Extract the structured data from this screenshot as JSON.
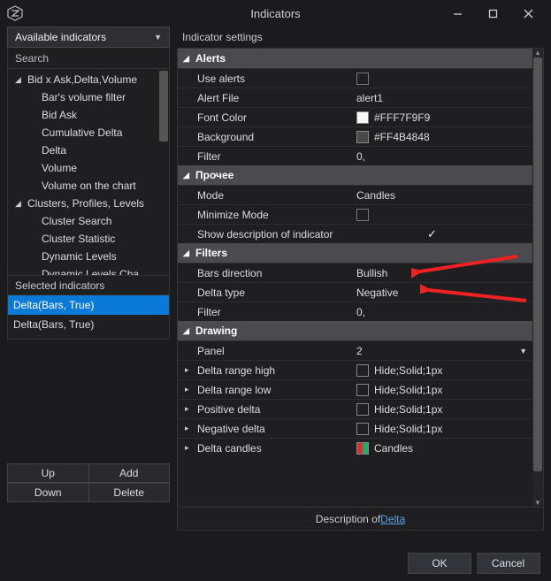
{
  "window": {
    "title": "Indicators"
  },
  "left": {
    "available_label": "Available indicators",
    "search_label": "Search",
    "tree": {
      "group1": {
        "label": "Bid x Ask,Delta,Volume"
      },
      "g1_items": [
        "Bar's volume filter",
        "Bid Ask",
        "Cumulative Delta",
        "Delta",
        "Volume",
        "Volume on the chart"
      ],
      "group2": {
        "label": "Clusters, Profiles, Levels"
      },
      "g2_items": [
        "Cluster Search",
        "Cluster Statistic",
        "Dynamic Levels",
        "Dynamic Levels Cha"
      ]
    },
    "selected_label": "Selected indicators",
    "selected": [
      "Delta(Bars, True)",
      "Delta(Bars, True)"
    ],
    "buttons": {
      "up": "Up",
      "add": "Add",
      "down": "Down",
      "delete": "Delete"
    }
  },
  "right": {
    "header": "Indicator settings",
    "groups": {
      "alerts": {
        "title": "Alerts",
        "use_alerts": "Use alerts",
        "alert_file": "Alert File",
        "alert_file_v": "alert1",
        "font_color": "Font Color",
        "font_color_v": "#FFF7F9F9",
        "background": "Background",
        "background_v": "#FF4B4848",
        "filter": "Filter",
        "filter_v": "0,"
      },
      "other": {
        "title": "Прочее",
        "mode": "Mode",
        "mode_v": "Candles",
        "minimize": "Minimize Mode",
        "show_desc": "Show description of indicator"
      },
      "filters": {
        "title": "Filters",
        "bars_dir": "Bars direction",
        "bars_dir_v": "Bullish",
        "delta_type": "Delta type",
        "delta_type_v": "Negative",
        "filter": "Filter",
        "filter_v": "0,"
      },
      "drawing": {
        "title": "Drawing",
        "panel": "Panel",
        "panel_v": "2",
        "drh": "Delta range high",
        "drh_v": "Hide;Solid;1px",
        "drl": "Delta range low",
        "drl_v": "Hide;Solid;1px",
        "pos": "Positive delta",
        "pos_v": "Hide;Solid;1px",
        "neg": "Negative delta",
        "neg_v": "Hide;Solid;1px",
        "dc": "Delta candles",
        "dc_v": "Candles"
      }
    },
    "desc_prefix": "Description of ",
    "desc_link": "Delta"
  },
  "footer": {
    "ok": "OK",
    "cancel": "Cancel"
  }
}
